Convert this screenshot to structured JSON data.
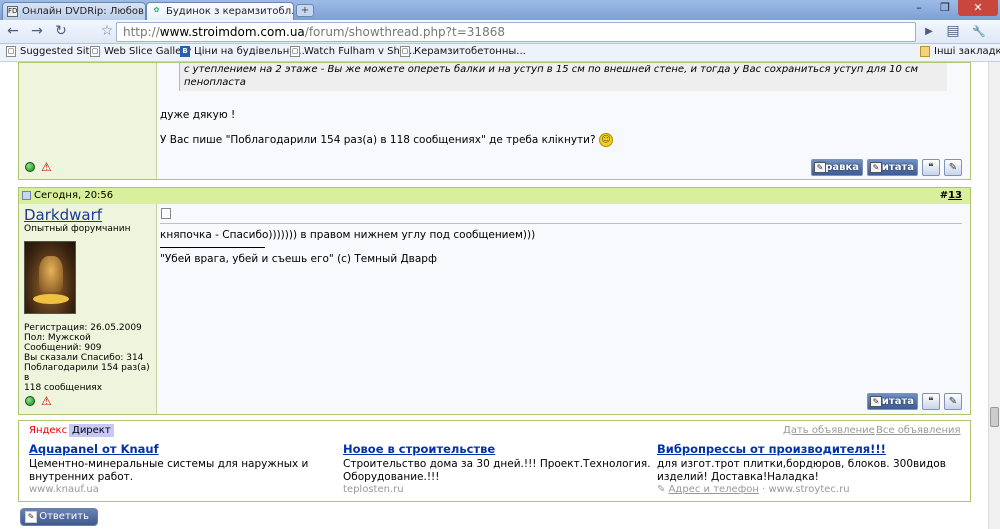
{
  "tabs": [
    {
      "favicon": "FD",
      "label": "Онлайн DVDRip: Любов ...",
      "close": "×"
    },
    {
      "favicon": "✿",
      "label": "Будинок з керамзитобл...",
      "close": "×"
    }
  ],
  "new_tab": "+",
  "window_controls": [
    "–",
    "❐",
    "✕"
  ],
  "nav": {
    "back": "←",
    "forward": "→",
    "reload": "↻",
    "star": "☆",
    "go": "▶",
    "page_menu": "▤",
    "tools_menu": "🔧"
  },
  "address": {
    "scheme": "http://",
    "host": "www.stroimdom.com.ua",
    "path": "/forum/showthread.php?t=31868"
  },
  "bookmarks": [
    {
      "icon": "▢",
      "label": "Suggested Sites"
    },
    {
      "icon": "▢",
      "label": "Web Slice Gallery"
    },
    {
      "icon": "B",
      "label": "Ціни на будівельні ..."
    },
    {
      "icon": "▢",
      "label": "Watch Fulham v Sha..."
    },
    {
      "icon": "▢",
      "label": "Керамзитобетонны..."
    }
  ],
  "other_bookmarks": "Інші закладки",
  "post1": {
    "quote_line1": "с утеплением на 2 этаже - Вы же можете опереть балки и на уступ в 15 см по внешней стене, и тогда у Вас сохраниться уступ для 10 см",
    "quote_line2": "пенопласта",
    "text1": "дуже дякую !",
    "text2": "У Вас пише \"Поблагодарили 154 раз(а) в 118 сообщениях\" де треба клікнути?",
    "btn_edit": "Правка",
    "btn_quote": "Цитата"
  },
  "post2": {
    "date": "Сегодня, 20:56",
    "number_prefix": "#",
    "number": "13",
    "username": "Darkdwarf",
    "rank": "Опытный форумчанин",
    "info": [
      "Регистрация: 26.05.2009",
      "Пол: Мужской",
      "Сообщений: 909",
      "Вы сказали Спасибо: 314",
      "Поблагодарили 154 раз(а) в",
      "118 сообщениях"
    ],
    "text": "княпочка - Спасибо))))))) в правом нижнем углу под сообщением)))",
    "signature": "\"Убей врага, убей и съешь его\" (с) Темный Дварф",
    "btn_quote": "Цитата"
  },
  "ads": {
    "yandex": "Яндекс",
    "direct": "Директ",
    "link_add": "Дать объявление",
    "link_all": "Все объявления",
    "items": [
      {
        "title": "Aquapanel от Knauf",
        "desc1": "Цементно-минеральные системы для наружных и",
        "desc2": "внутренних работ.",
        "url": "www.knauf.ua"
      },
      {
        "title": "Новое в строительстве",
        "desc1": "Строительство дома за 30 дней.!!! Проект.Технология.",
        "desc2": "Оборудование.!!!",
        "url": "teplosten.ru"
      },
      {
        "title": "Вибропрессы от производителя!!!",
        "desc1": "для изгот.трот плитки,бордюров, блоков. 300видов",
        "desc2": "изделий! Доставка!Наладка!",
        "url": "Адрес и телефон",
        "url_sep": "·",
        "url2": "www.stroytec.ru"
      }
    ]
  },
  "reply_button": "Ответить"
}
